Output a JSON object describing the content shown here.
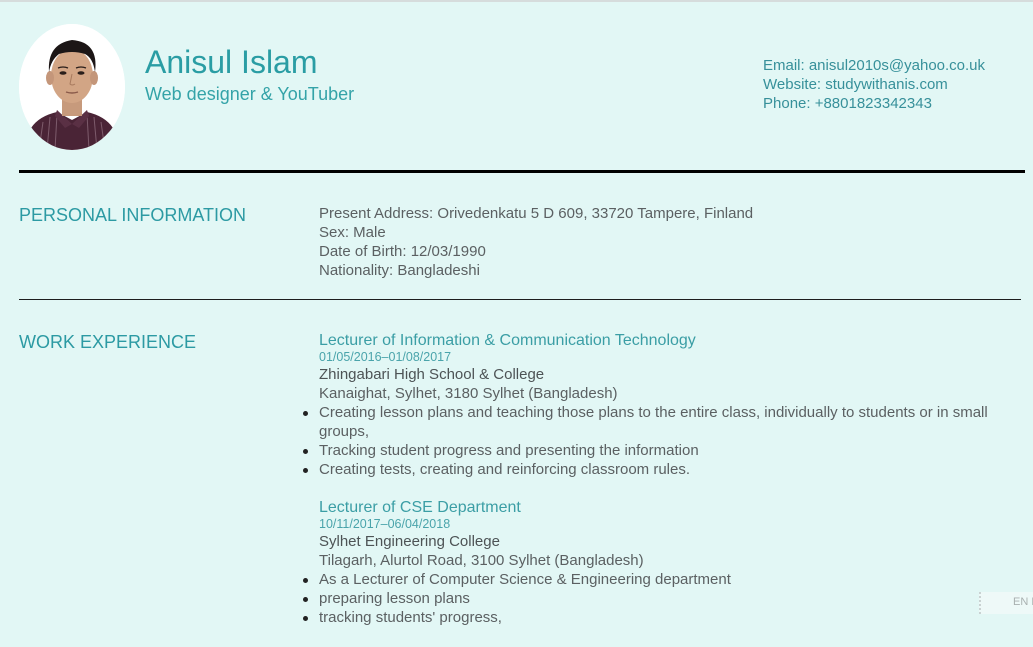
{
  "header": {
    "name": "Anisul Islam",
    "tagline": "Web designer & YouTuber",
    "avatar_alt": "profile-photo",
    "contact": {
      "email": "Email: anisul2010s@yahoo.co.uk",
      "website": "Website: studywithanis.com",
      "phone": "Phone: +8801823342343"
    }
  },
  "personal": {
    "title": "PERSONAL INFORMATION",
    "lines": [
      "Present Address: Orivedenkatu 5 D 609, 33720 Tampere, Finland",
      "Sex: Male",
      "Date of Birth: 12/03/1990",
      "Nationality: Bangladeshi"
    ]
  },
  "work": {
    "title": "WORK EXPERIENCE",
    "jobs": [
      {
        "title": "Lecturer of Information & Communication Technology",
        "dates": "01/05/2016–01/08/2017",
        "org": "Zhingabari High School & College",
        "location": "Kanaighat, Sylhet, 3180 Sylhet (Bangladesh)",
        "duties": [
          "Creating lesson plans and teaching those plans to the entire class, individually to students or in small groups,",
          "Tracking student progress and presenting the information",
          "Creating tests, creating and reinforcing classroom rules."
        ]
      },
      {
        "title": "Lecturer of CSE Department",
        "dates": "10/11/2017–06/04/2018",
        "org": "Sylhet Engineering College",
        "location": "Tilagarh, Alurtol Road, 3100 Sylhet (Bangladesh)",
        "duties": [
          "As a Lecturer of Computer Science & Engineering department",
          "preparing lesson plans",
          "tracking students' progress,"
        ]
      }
    ]
  },
  "language_widget": {
    "label": "EN E"
  },
  "colors": {
    "background": "#e2f7f5",
    "accent": "#2a9da4",
    "text": "#5b6062"
  }
}
